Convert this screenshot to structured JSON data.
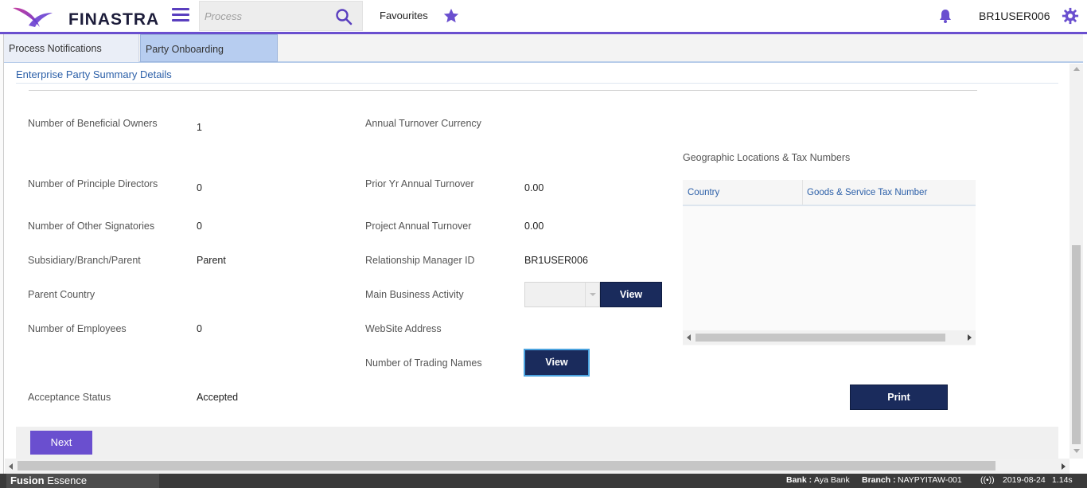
{
  "header": {
    "logo_text": "FINASTRA",
    "search_placeholder": "Process",
    "favourites_label": "Favourites",
    "user": "BR1USER006",
    "accent_color": "#6a4fcf"
  },
  "tabs": [
    {
      "label": "Process Notifications"
    },
    {
      "label": "Party Onboarding",
      "active": true
    }
  ],
  "section": {
    "title": "Enterprise Party Summary Details"
  },
  "fields": {
    "beneficial_owners": {
      "label": "Number of Beneficial Owners",
      "value": "1"
    },
    "principle_directors": {
      "label": "Number of Principle Directors",
      "value": "0"
    },
    "other_signatories": {
      "label": "Number of Other Signatories",
      "value": "0"
    },
    "subsidiary": {
      "label": "Subsidiary/Branch/Parent",
      "value": "Parent"
    },
    "parent_country": {
      "label": "Parent Country",
      "value": ""
    },
    "employees": {
      "label": "Number of Employees",
      "value": "0"
    },
    "acceptance_status": {
      "label": "Acceptance Status",
      "value": "Accepted"
    },
    "turnover_currency": {
      "label": "Annual Turnover Currency",
      "value": ""
    },
    "prior_turnover": {
      "label": "Prior Yr Annual Turnover",
      "value": "0.00"
    },
    "project_turnover": {
      "label": "Project Annual Turnover",
      "value": "0.00"
    },
    "relationship_manager": {
      "label": "Relationship Manager ID",
      "value": "BR1USER006"
    },
    "main_business": {
      "label": "Main Business Activity",
      "value": ""
    },
    "website": {
      "label": "WebSite Address",
      "value": ""
    },
    "trading_names": {
      "label": "Number of Trading Names"
    }
  },
  "buttons": {
    "view": "View",
    "print": "Print",
    "next": "Next"
  },
  "geo_table": {
    "title": "Geographic Locations & Tax Numbers",
    "columns": [
      "Country",
      "Goods & Service Tax Number"
    ],
    "rows": []
  },
  "statusbar": {
    "brand_bold": "Fusion",
    "brand_rest": " Essence",
    "bank_label": "Bank :",
    "bank_value": "Aya Bank",
    "branch_label": "Branch :",
    "branch_value": "NAYPYITAW-001",
    "signal": "((•))",
    "date": "2019-08-24",
    "time": "1.14s"
  }
}
